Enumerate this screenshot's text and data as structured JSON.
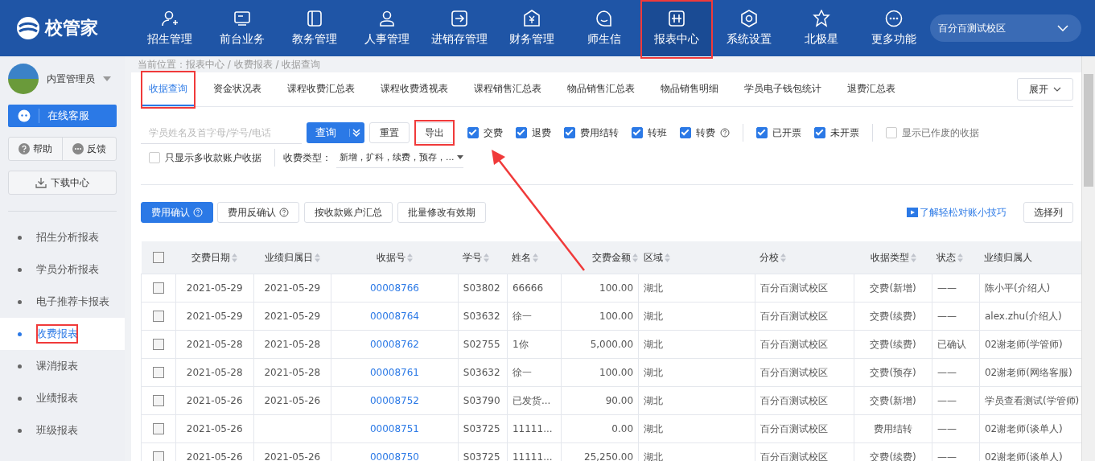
{
  "header": {
    "logo": "校管家",
    "nav": [
      {
        "label": "招生管理",
        "selected": false,
        "highlighted": false
      },
      {
        "label": "前台业务",
        "selected": false,
        "highlighted": false
      },
      {
        "label": "教务管理",
        "selected": false,
        "highlighted": false
      },
      {
        "label": "人事管理",
        "selected": false,
        "highlighted": false
      },
      {
        "label": "进销存管理",
        "selected": false,
        "highlighted": false
      },
      {
        "label": "财务管理",
        "selected": false,
        "highlighted": false
      },
      {
        "label": "师生信",
        "selected": false,
        "highlighted": false
      },
      {
        "label": "报表中心",
        "selected": true,
        "highlighted": true
      },
      {
        "label": "系统设置",
        "selected": false,
        "highlighted": false
      },
      {
        "label": "北极星",
        "selected": false,
        "highlighted": false
      },
      {
        "label": "更多功能",
        "selected": false,
        "highlighted": false
      }
    ],
    "campus": "百分百测试校区"
  },
  "sidebar": {
    "user": "内置管理员",
    "support": "在线客服",
    "help": "帮助",
    "feedback": "反馈",
    "download": "下载中心",
    "items": [
      {
        "label": "招生分析报表",
        "selected": false,
        "highlighted": false
      },
      {
        "label": "学员分析报表",
        "selected": false,
        "highlighted": false
      },
      {
        "label": "电子推荐卡报表",
        "selected": false,
        "highlighted": false
      },
      {
        "label": "收费报表",
        "selected": true,
        "highlighted": true
      },
      {
        "label": "课消报表",
        "selected": false,
        "highlighted": false
      },
      {
        "label": "业绩报表",
        "selected": false,
        "highlighted": false
      },
      {
        "label": "班级报表",
        "selected": false,
        "highlighted": false
      }
    ]
  },
  "breadcrumb": "当前位置：报表中心 / 收费报表 / 收据查询",
  "tabs": [
    {
      "label": "收据查询",
      "selected": true,
      "highlighted": true
    },
    {
      "label": "资金状况表",
      "selected": false,
      "highlighted": false
    },
    {
      "label": "课程收费汇总表",
      "selected": false,
      "highlighted": false
    },
    {
      "label": "课程收费透视表",
      "selected": false,
      "highlighted": false
    },
    {
      "label": "课程销售汇总表",
      "selected": false,
      "highlighted": false
    },
    {
      "label": "物品销售汇总表",
      "selected": false,
      "highlighted": false
    },
    {
      "label": "物品销售明细",
      "selected": false,
      "highlighted": false
    },
    {
      "label": "学员电子钱包统计",
      "selected": false,
      "highlighted": false
    },
    {
      "label": "退费汇总表",
      "selected": false,
      "highlighted": false
    }
  ],
  "expand": "展开",
  "filters": {
    "search_placeholder": "学员姓名及首字母/学号/电话",
    "query": "查询",
    "reset": "重置",
    "export": {
      "label": "导出",
      "highlighted": true
    },
    "check_groups": [
      [
        {
          "label": "交费",
          "checked": true,
          "help": false,
          "pointed": true
        },
        {
          "label": "退费",
          "checked": true,
          "help": false,
          "pointed": false
        },
        {
          "label": "费用结转",
          "checked": true,
          "help": false,
          "pointed": false
        },
        {
          "label": "转班",
          "checked": true,
          "help": false,
          "pointed": false
        },
        {
          "label": "转费",
          "checked": true,
          "help": true,
          "pointed": false
        }
      ],
      [
        {
          "label": "已开票",
          "checked": true,
          "help": false,
          "pointed": false
        },
        {
          "label": "未开票",
          "checked": true,
          "help": false,
          "pointed": false
        }
      ],
      [
        {
          "label": "显示已作废的收据",
          "checked": false,
          "help": false,
          "pointed": false
        }
      ]
    ],
    "only_multi": {
      "label": "只显示多收款账户收据",
      "checked": false
    },
    "fee_type": {
      "label": "收费类型：",
      "value": "新增，扩科，续费，预存，..."
    }
  },
  "actions": [
    {
      "label": "费用确认",
      "primary": true,
      "help": true
    },
    {
      "label": "费用反确认",
      "primary": false,
      "help": true
    },
    {
      "label": "按收款账户汇总",
      "primary": false,
      "help": false
    },
    {
      "label": "批量修改有效期",
      "primary": false,
      "help": false
    }
  ],
  "tip_link": "了解轻松对账小技巧",
  "choose_columns": "选择列",
  "table": {
    "all_checked": false,
    "columns": [
      {
        "label": "交费日期",
        "sortable": true
      },
      {
        "label": "业绩归属日",
        "sortable": true
      },
      {
        "label": "收据号",
        "sortable": true
      },
      {
        "label": "学号",
        "sortable": true
      },
      {
        "label": "姓名",
        "sortable": true
      },
      {
        "label": "交费金额",
        "sortable": true
      },
      {
        "label": "区域",
        "sortable": true
      },
      {
        "label": "分校",
        "sortable": true
      },
      {
        "label": "收据类型",
        "sortable": true
      },
      {
        "label": "状态",
        "sortable": true
      },
      {
        "label": "业绩归属人",
        "sortable": false
      }
    ],
    "rows": [
      {
        "checked": false,
        "cells": [
          "2021-05-29",
          "2021-05-29",
          "00008766",
          "S03802",
          "66666",
          "100.00",
          "湖北",
          "百分百测试校区",
          "交费(新增)",
          "——",
          "陈小平(介绍人)"
        ]
      },
      {
        "checked": false,
        "cells": [
          "2021-05-29",
          "2021-05-29",
          "00008764",
          "S03632",
          "徐一",
          "100.00",
          "湖北",
          "百分百测试校区",
          "交费(续费)",
          "——",
          "alex.zhu(介绍人)"
        ]
      },
      {
        "checked": false,
        "cells": [
          "2021-05-28",
          "2021-05-28",
          "00008762",
          "S02755",
          "1你",
          "5,000.00",
          "湖北",
          "百分百测试校区",
          "交费(续费)",
          "已确认",
          "02谢老师(学管师)"
        ]
      },
      {
        "checked": false,
        "cells": [
          "2021-05-28",
          "2021-05-28",
          "00008761",
          "S03632",
          "徐一",
          "100.00",
          "湖北",
          "百分百测试校区",
          "交费(预存)",
          "——",
          "02谢老师(网络客服)"
        ]
      },
      {
        "checked": false,
        "cells": [
          "2021-05-26",
          "2021-05-26",
          "00008752",
          "S03790",
          "已发货...",
          "90.00",
          "湖北",
          "百分百测试校区",
          "交费(新增)",
          "——",
          "学员查看测试(学管师)"
        ]
      },
      {
        "checked": false,
        "cells": [
          "2021-05-26",
          "",
          "00008751",
          "S03725",
          "11111...",
          "0.00",
          "湖北",
          "百分百测试校区",
          "费用结转",
          "——",
          "02谢老师(谈单人)"
        ]
      },
      {
        "checked": false,
        "cells": [
          "2021-05-26",
          "2021-05-26",
          "00008750",
          "S03725",
          "11111...",
          "25,250.00",
          "湖北",
          "百分百测试校区",
          "交费(续费)",
          "——",
          "02谢老师(谈单人)"
        ]
      }
    ]
  }
}
